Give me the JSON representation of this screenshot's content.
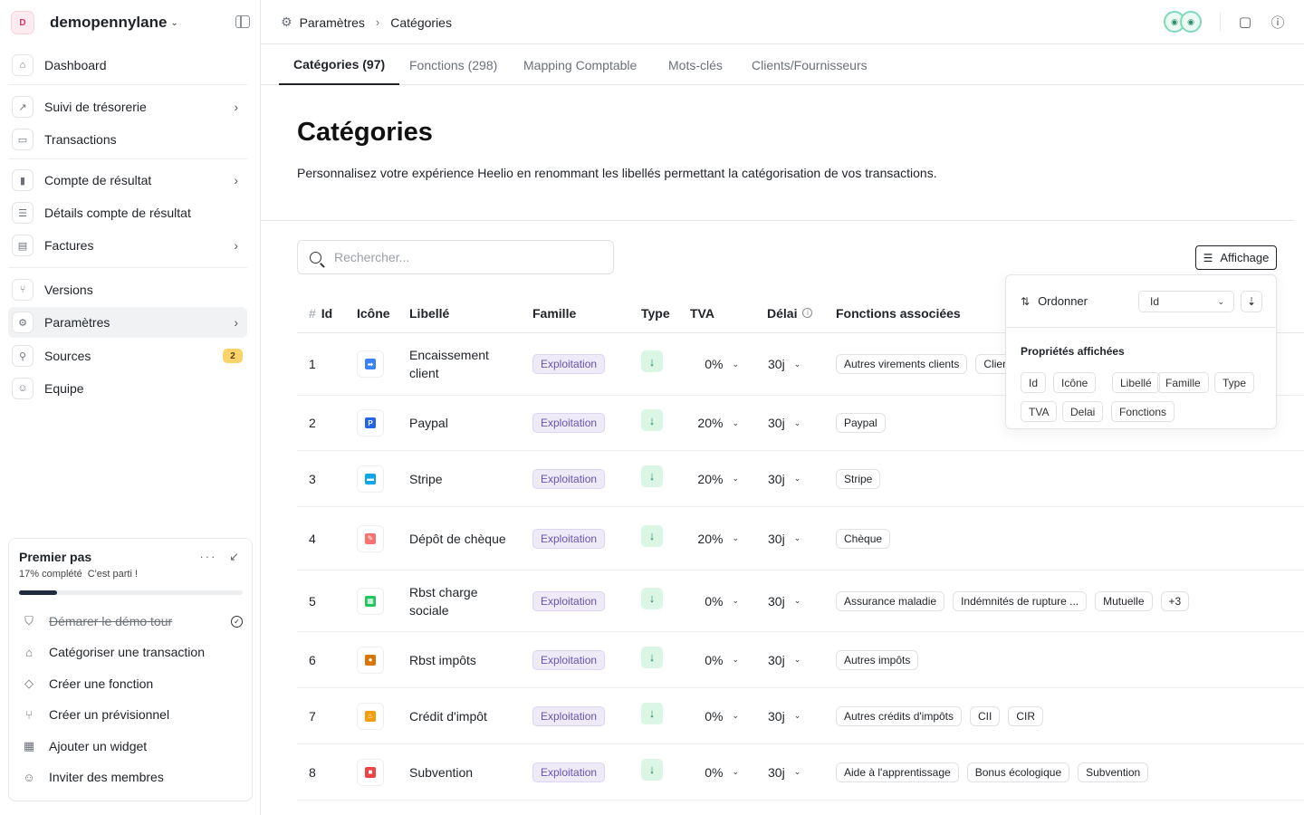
{
  "workspace": {
    "badge": "D",
    "name": "demopennylane"
  },
  "sidebar": {
    "items": [
      {
        "label": "Dashboard",
        "icon": "home-icon"
      },
      {
        "label": "Suivi de trésorerie",
        "icon": "chart-icon",
        "chevron": true
      },
      {
        "label": "Transactions",
        "icon": "card-icon"
      },
      {
        "label": "Compte de résultat",
        "icon": "bar-chart-icon",
        "chevron": true
      },
      {
        "label": "Détails compte de résultat",
        "icon": "list-icon"
      },
      {
        "label": "Factures",
        "icon": "invoice-icon",
        "chevron": true
      },
      {
        "label": "Versions",
        "icon": "versions-icon"
      },
      {
        "label": "Paramètres",
        "icon": "gear-icon",
        "chevron": true,
        "active": true
      },
      {
        "label": "Sources",
        "icon": "plug-icon",
        "badge": "2"
      },
      {
        "label": "Equipe",
        "icon": "user-icon"
      }
    ]
  },
  "onboarding": {
    "title": "Premier pas",
    "progress_text": "17% complété",
    "progress_note": "C'est parti !",
    "progress": 0.17,
    "items": [
      {
        "label": "Démarer le démo tour",
        "done": true
      },
      {
        "label": "Catégoriser une transaction"
      },
      {
        "label": "Créer une fonction"
      },
      {
        "label": "Créer un prévisionnel"
      },
      {
        "label": "Ajouter un widget"
      },
      {
        "label": "Inviter des membres"
      }
    ]
  },
  "breadcrumb": {
    "root": "Paramètres",
    "current": "Catégories"
  },
  "tabs": [
    {
      "label": "Catégories (97)",
      "active": true
    },
    {
      "label": "Fonctions (298)"
    },
    {
      "label": "Mapping Comptable"
    },
    {
      "label": "Mots-clés"
    },
    {
      "label": "Clients/Fournisseurs"
    }
  ],
  "page": {
    "title": "Catégories",
    "description": "Personnalisez votre expérience Heelio en renommant les libellés permettant la catégorisation de vos transactions."
  },
  "search": {
    "placeholder": "Rechercher..."
  },
  "display_button": "Affichage",
  "table": {
    "headers": {
      "id": "Id",
      "icon": "Icône",
      "label": "Libellé",
      "family": "Famille",
      "type": "Type",
      "tva": "TVA",
      "delay": "Délai",
      "functions": "Fonctions associées"
    },
    "rows": [
      {
        "id": "1",
        "label": "Encaissement client",
        "family": "Exploitation",
        "tva": "0%",
        "delay": "30j",
        "functions": [
          "Autres virements clients",
          "Clien"
        ],
        "icon_color": "#3b82f6",
        "icon_glyph": "➡"
      },
      {
        "id": "2",
        "label": "Paypal",
        "family": "Exploitation",
        "tva": "20%",
        "delay": "30j",
        "functions": [
          "Paypal"
        ],
        "icon_color": "#2563eb",
        "icon_glyph": "P"
      },
      {
        "id": "3",
        "label": "Stripe",
        "family": "Exploitation",
        "tva": "20%",
        "delay": "30j",
        "functions": [
          "Stripe"
        ],
        "icon_color": "#0ea5e9",
        "icon_glyph": "▬"
      },
      {
        "id": "4",
        "label": "Dépôt de chèque",
        "family": "Exploitation",
        "tva": "20%",
        "delay": "30j",
        "functions": [
          "Chèque"
        ],
        "icon_color": "#f87171",
        "icon_glyph": "✎"
      },
      {
        "id": "5",
        "label": "Rbst charge sociale",
        "family": "Exploitation",
        "tva": "0%",
        "delay": "30j",
        "functions": [
          "Assurance maladie",
          "Indémnités de rupture ...",
          "Mutuelle",
          "+3"
        ],
        "icon_color": "#22c55e",
        "icon_glyph": "▦"
      },
      {
        "id": "6",
        "label": "Rbst impôts",
        "family": "Exploitation",
        "tva": "0%",
        "delay": "30j",
        "functions": [
          "Autres impôts"
        ],
        "icon_color": "#d97706",
        "icon_glyph": "●"
      },
      {
        "id": "7",
        "label": "Crédit d'impôt",
        "family": "Exploitation",
        "tva": "0%",
        "delay": "30j",
        "functions": [
          "Autres crédits d'impôts",
          "CII",
          "CIR"
        ],
        "icon_color": "#f59e0b",
        "icon_glyph": "♨"
      },
      {
        "id": "8",
        "label": "Subvention",
        "family": "Exploitation",
        "tva": "0%",
        "delay": "30j",
        "functions": [
          "Aide à l'apprentissage",
          "Bonus écologique",
          "Subvention"
        ],
        "icon_color": "#ef4444",
        "icon_glyph": "■"
      }
    ]
  },
  "display_panel": {
    "order_label": "Ordonner",
    "order_value": "Id",
    "props_title": "Propriétés affichées",
    "props": [
      "Id",
      "Icône",
      "Libellé",
      "Famille",
      "Type",
      "TVA",
      "Delai",
      "Fonctions"
    ]
  }
}
